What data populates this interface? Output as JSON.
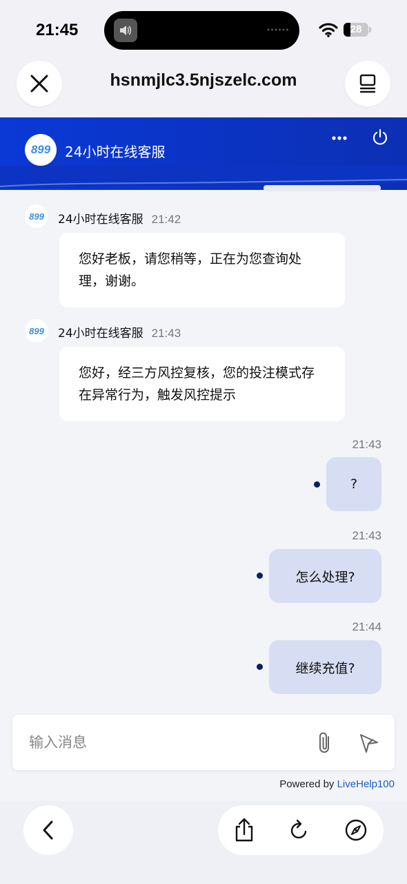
{
  "status_bar": {
    "time": "21:45",
    "battery": "28",
    "battery_level": 0.28
  },
  "browser": {
    "url": "hsnmjlc3.5njszelc.com",
    "close_icon": "close-icon",
    "tabs_icon": "tabs-icon"
  },
  "chat_header": {
    "agent_name": "24小时在线客服",
    "logo_text": "899",
    "colors": {
      "header_bg": "#0a39d6",
      "outgoing_bubble": "#d7ddf2",
      "dot": "#0b1e6a"
    }
  },
  "messages": [
    {
      "direction": "incoming",
      "sender": "24小时在线客服",
      "time": "21:42",
      "text": "您好老板，请您稍等，正在为您查询处理，谢谢。"
    },
    {
      "direction": "incoming",
      "sender": "24小时在线客服",
      "time": "21:43",
      "text": "您好，经三方风控复核，您的投注模式存在异常行为，触发风控提示"
    },
    {
      "direction": "outgoing",
      "time": "21:43",
      "text": "?"
    },
    {
      "direction": "outgoing",
      "time": "21:43",
      "text": "怎么处理?"
    },
    {
      "direction": "outgoing",
      "time": "21:44",
      "text": "继续充值?"
    }
  ],
  "composer": {
    "placeholder": "输入消息",
    "value": ""
  },
  "footer": {
    "powered_by": "Powered by",
    "brand": "LiveHelp100"
  }
}
